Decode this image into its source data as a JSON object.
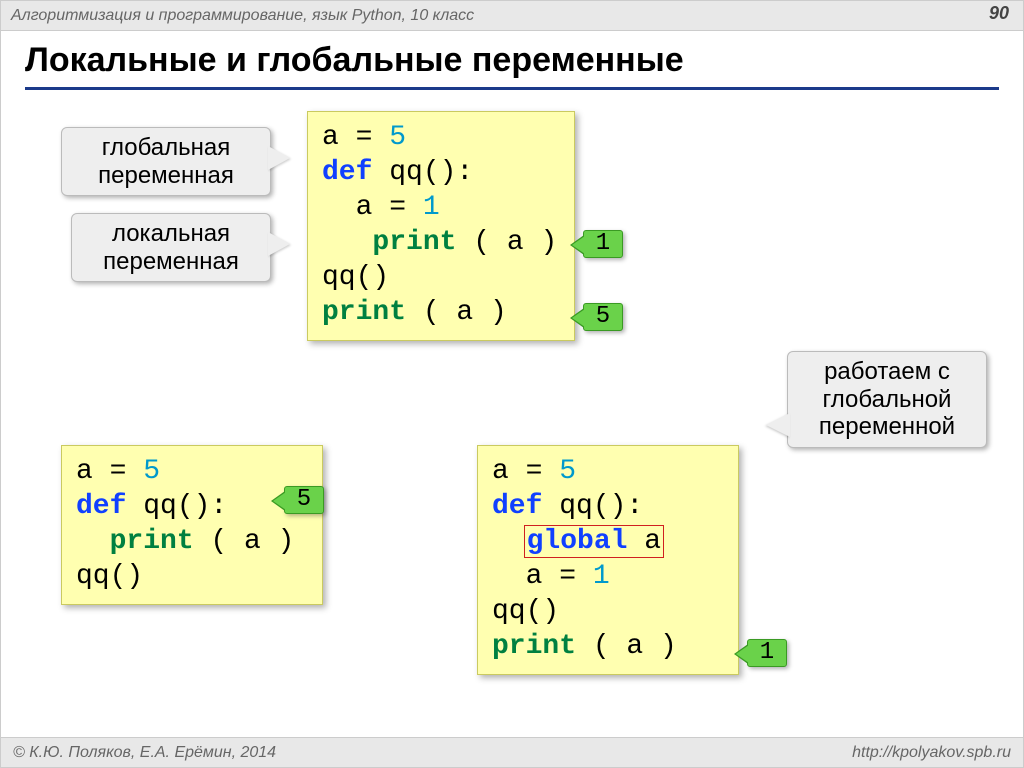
{
  "meta": {
    "header": "Алгоритмизация и программирование, язык Python, 10 класс",
    "page_number": "90",
    "footer_left": "© К.Ю. Поляков, Е.А. Ерёмин, 2014",
    "footer_right": "http://kpolyakov.spb.ru"
  },
  "title": "Локальные и глобальные переменные",
  "callouts": {
    "global_var": {
      "l1": "глобальная",
      "l2": "переменная"
    },
    "local_var": {
      "l1": "локальная",
      "l2": "переменная"
    },
    "global_use": {
      "l1": "работаем с",
      "l2": "глобальной",
      "l3": "переменной"
    }
  },
  "outputs": {
    "code1_line4": "1",
    "code1_line6": "5",
    "code2_line3": "5",
    "code3_line6": "1"
  },
  "code1": {
    "l1_a": "a",
    "l1_eq": " = ",
    "l1_v": "5",
    "l2_def": "def",
    "l2_rest": " qq():",
    "l3": "  a",
    "l3_eq": " = ",
    "l3_v": "1",
    "l4_indent": "   ",
    "l4_fn": "print",
    "l4_args": " ( a )",
    "l5": "qq()",
    "l6_fn": "print",
    "l6_args": " ( a )"
  },
  "code2": {
    "l1_a": "a",
    "l1_eq": " = ",
    "l1_v": "5",
    "l2_def": "def",
    "l2_rest": " qq():",
    "l3_indent": "  ",
    "l3_fn": "print",
    "l3_args": " ( a )",
    "l4": "qq()"
  },
  "code3": {
    "l1_a": "a",
    "l1_eq": " = ",
    "l1_v": "5",
    "l2_def": "def",
    "l2_rest": " qq():",
    "l3_indent": "  ",
    "l3_kw": "global",
    "l3_rest": " a",
    "l4_indent": "  a",
    "l4_eq": " = ",
    "l4_v": "1",
    "l5": "qq()",
    "l6_fn": "print",
    "l6_args": " ( a )"
  }
}
